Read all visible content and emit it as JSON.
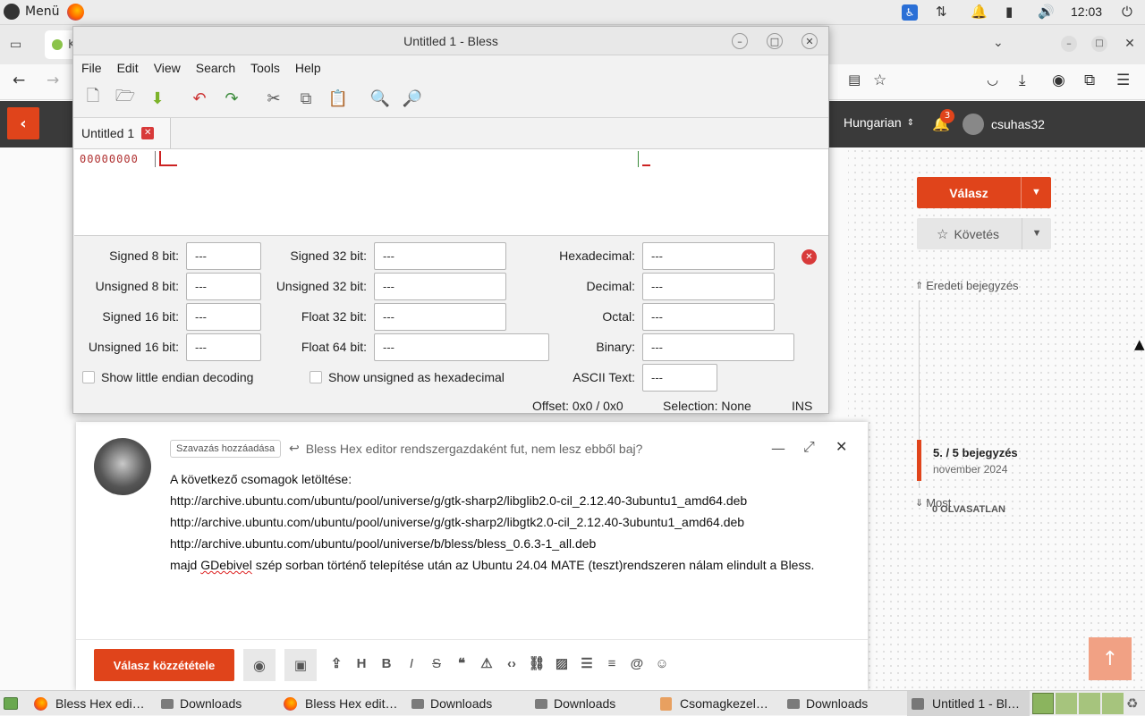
{
  "toppanel": {
    "menu_label": "Menü",
    "clock": "12:03"
  },
  "browser": {
    "tab_partial": "K",
    "site_language": "Hungarian",
    "notif_count": "3",
    "username": "csuhas32"
  },
  "sidebar": {
    "reply_label": "Válasz",
    "follow_label": "Követés",
    "original_post": "Eredeti bejegyzés",
    "position": "5. / 5 bejegyzés",
    "date": "november 2024",
    "now_label": "Most",
    "unread": "0 OLVASATLAN"
  },
  "composer": {
    "vote_tag": "Szavazás hozzáadása",
    "reply_title": "Bless Hex editor rendszergazdaként fut, nem lesz ebből baj?",
    "lines": [
      "A következő csomagok letöltése:",
      "http://archive.ubuntu.com/ubuntu/pool/universe/g/gtk-sharp2/libglib2.0-cil_2.12.40-3ubuntu1_amd64.deb",
      "http://archive.ubuntu.com/ubuntu/pool/universe/g/gtk-sharp2/libgtk2.0-cil_2.12.40-3ubuntu1_amd64.deb",
      "http://archive.ubuntu.com/ubuntu/pool/universe/b/bless/bless_0.6.3-1_all.deb"
    ],
    "last_line_pre": "majd ",
    "last_line_word": "GDebivel",
    "last_line_post": " szép sorban történő telepítése után az Ubuntu 24.04 MATE (teszt)rendszeren nálam elindult a Bless.",
    "post_button": "Válasz közzététele"
  },
  "bless": {
    "title": "Untitled 1 - Bless",
    "menu": [
      "File",
      "Edit",
      "View",
      "Search",
      "Tools",
      "Help"
    ],
    "tab_label": "Untitled 1",
    "offset_addr": "00000000",
    "labels": {
      "s8": "Signed 8 bit:",
      "u8": "Unsigned 8 bit:",
      "s16": "Signed 16 bit:",
      "u16": "Unsigned 16 bit:",
      "s32": "Signed 32 bit:",
      "u32": "Unsigned 32 bit:",
      "f32": "Float 32 bit:",
      "f64": "Float 64 bit:",
      "hex": "Hexadecimal:",
      "dec": "Decimal:",
      "oct": "Octal:",
      "bin": "Binary:",
      "ascii": "ASCII Text:"
    },
    "empty_value": "---",
    "little_endian": "Show little endian decoding",
    "unsigned_hex": "Show unsigned as hexadecimal",
    "status_offset": "Offset: 0x0 / 0x0",
    "status_selection": "Selection: None",
    "status_mode": "INS"
  },
  "taskbar": {
    "items": [
      "Bless Hex edi…",
      "Downloads",
      "Bless Hex edit…",
      "Downloads",
      "Downloads",
      "Csomagkezel…",
      "Downloads",
      "Untitled 1 - Bl…"
    ]
  }
}
